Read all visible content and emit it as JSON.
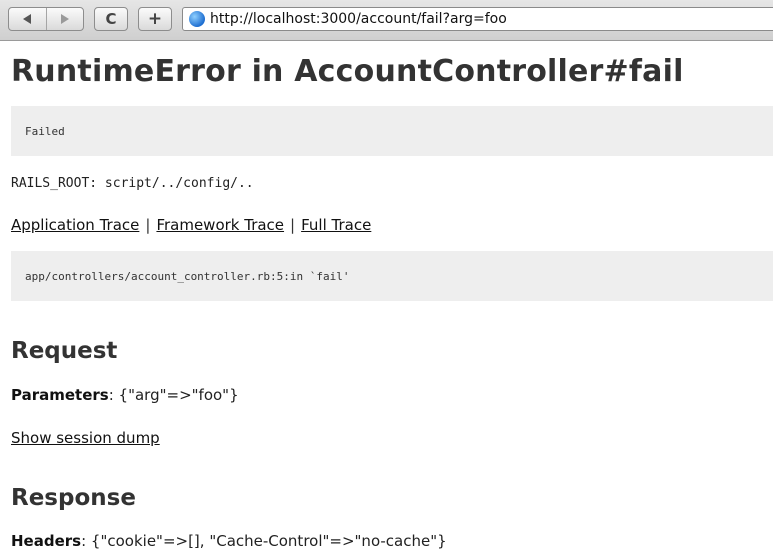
{
  "browser": {
    "url": "http://localhost:3000/account/fail?arg=foo",
    "back_icon": "back-arrow-icon",
    "forward_icon": "forward-arrow-icon",
    "reload_label": "C",
    "new_tab_label": "+"
  },
  "error": {
    "title": "RuntimeError in AccountController#fail",
    "message": "Failed",
    "rails_root": "RAILS_ROOT: script/../config/..",
    "trace_links": [
      "Application Trace",
      "Framework Trace",
      "Full Trace"
    ],
    "separator": "|",
    "trace_line": "app/controllers/account_controller.rb:5:in `fail'"
  },
  "request": {
    "heading": "Request",
    "params_label": "Parameters",
    "params_value": ": {\"arg\"=>\"foo\"}",
    "session_link": "Show session dump"
  },
  "response": {
    "heading": "Response",
    "headers_label": "Headers",
    "headers_value": ": {\"cookie\"=>[], \"Cache-Control\"=>\"no-cache\"}"
  }
}
